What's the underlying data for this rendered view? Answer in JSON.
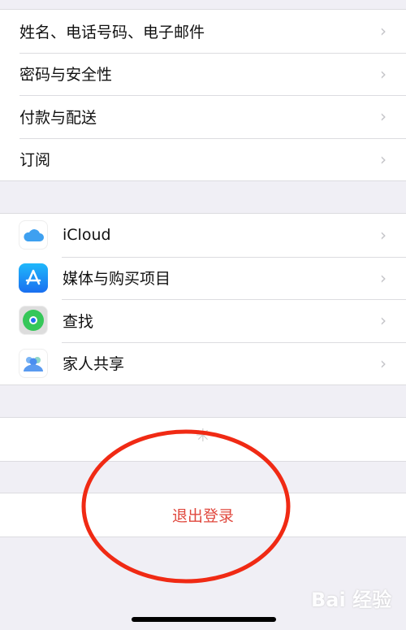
{
  "account_group": [
    {
      "label": "姓名、电话号码、电子邮件"
    },
    {
      "label": "密码与安全性"
    },
    {
      "label": "付款与配送"
    },
    {
      "label": "订阅"
    }
  ],
  "services_group": [
    {
      "label": "iCloud",
      "icon": "icloud-icon"
    },
    {
      "label": "媒体与购买项目",
      "icon": "app-store-icon"
    },
    {
      "label": "查找",
      "icon": "find-my-icon"
    },
    {
      "label": "家人共享",
      "icon": "family-sharing-icon"
    }
  ],
  "sign_out": {
    "label": "退出登录",
    "color": "#e0483e"
  },
  "annotation_color": "#f02a14",
  "watermark": "Bai 经验"
}
